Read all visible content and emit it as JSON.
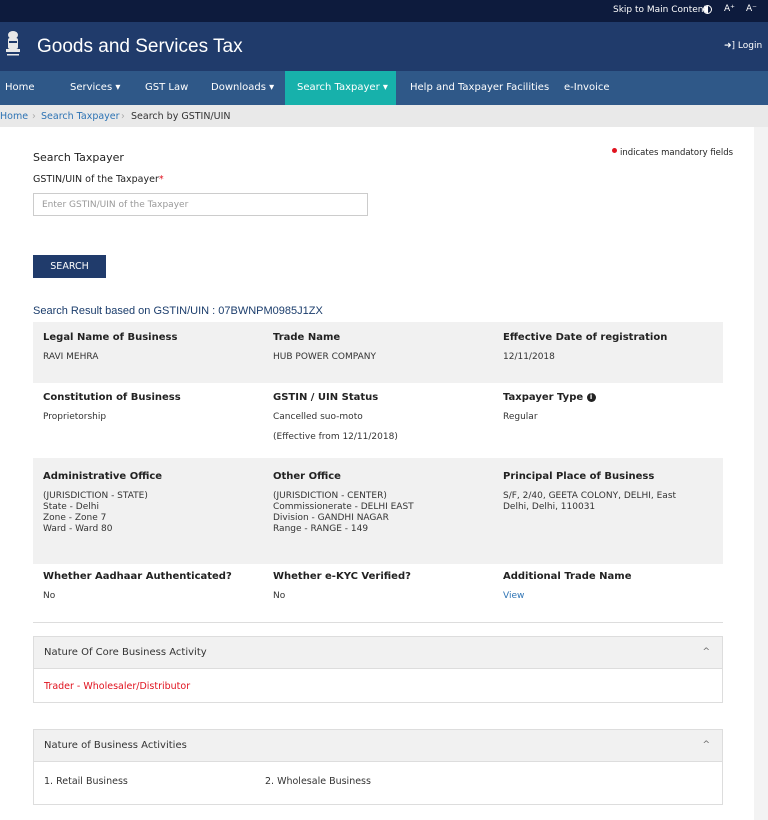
{
  "topbar": {
    "skip": "Skip to Main Content",
    "a_plus": "A⁺",
    "a_minus": "A⁻"
  },
  "header": {
    "title": "Goods and Services Tax",
    "login": "Login"
  },
  "nav": [
    {
      "label": "Home"
    },
    {
      "label": "Services"
    },
    {
      "label": "GST Law"
    },
    {
      "label": "Downloads"
    },
    {
      "label": "Search Taxpayer"
    },
    {
      "label": "Help and Taxpayer Facilities"
    },
    {
      "label": "e-Invoice"
    }
  ],
  "breadcrumb": {
    "home": "Home",
    "search": "Search Taxpayer",
    "current": "Search by GSTIN/UIN"
  },
  "form": {
    "title": "Search Taxpayer",
    "mandatory": "indicates mandatory fields",
    "field_label": "GSTIN/UIN of the Taxpayer",
    "placeholder": "Enter GSTIN/UIN of the Taxpayer",
    "button": "SEARCH"
  },
  "result": {
    "heading": "Search Result based on GSTIN/UIN : 07BWNPM0985J1ZX",
    "legal_name_label": "Legal Name of Business",
    "legal_name": "RAVI MEHRA",
    "trade_name_label": "Trade Name",
    "trade_name": "HUB POWER COMPANY",
    "eff_date_label": "Effective Date of registration",
    "eff_date": "12/11/2018",
    "constitution_label": "Constitution of Business",
    "constitution": "Proprietorship",
    "status_label": "GSTIN / UIN Status",
    "status": "Cancelled suo-moto",
    "status_effective": "(Effective from 12/11/2018)",
    "taxpayer_type_label": "Taxpayer Type",
    "taxpayer_type": "Regular",
    "admin_office_label": "Administrative Office",
    "admin_office": [
      "(JURISDICTION - STATE)",
      "State - Delhi",
      "Zone - Zone 7",
      "Ward - Ward 80"
    ],
    "other_office_label": "Other Office",
    "other_office": [
      "(JURISDICTION - CENTER)",
      "Commissionerate - DELHI EAST",
      "Division - GANDHI NAGAR",
      "Range - RANGE - 149"
    ],
    "ppob_label": "Principal Place of Business",
    "ppob": [
      "S/F, 2/40, GEETA COLONY, DELHI, East",
      "Delhi, Delhi, 110031"
    ],
    "aadhaar_label": "Whether Aadhaar Authenticated?",
    "aadhaar": "No",
    "ekyc_label": "Whether e-KYC Verified?",
    "ekyc": "No",
    "additional_trade_label": "Additional Trade Name",
    "additional_trade": "View"
  },
  "core_activity": {
    "title": "Nature Of Core Business Activity",
    "value": "Trader - Wholesaler/Distributor"
  },
  "activities": {
    "title": "Nature of Business Activities",
    "items": [
      "1. Retail Business",
      "2. Wholesale Business"
    ]
  }
}
